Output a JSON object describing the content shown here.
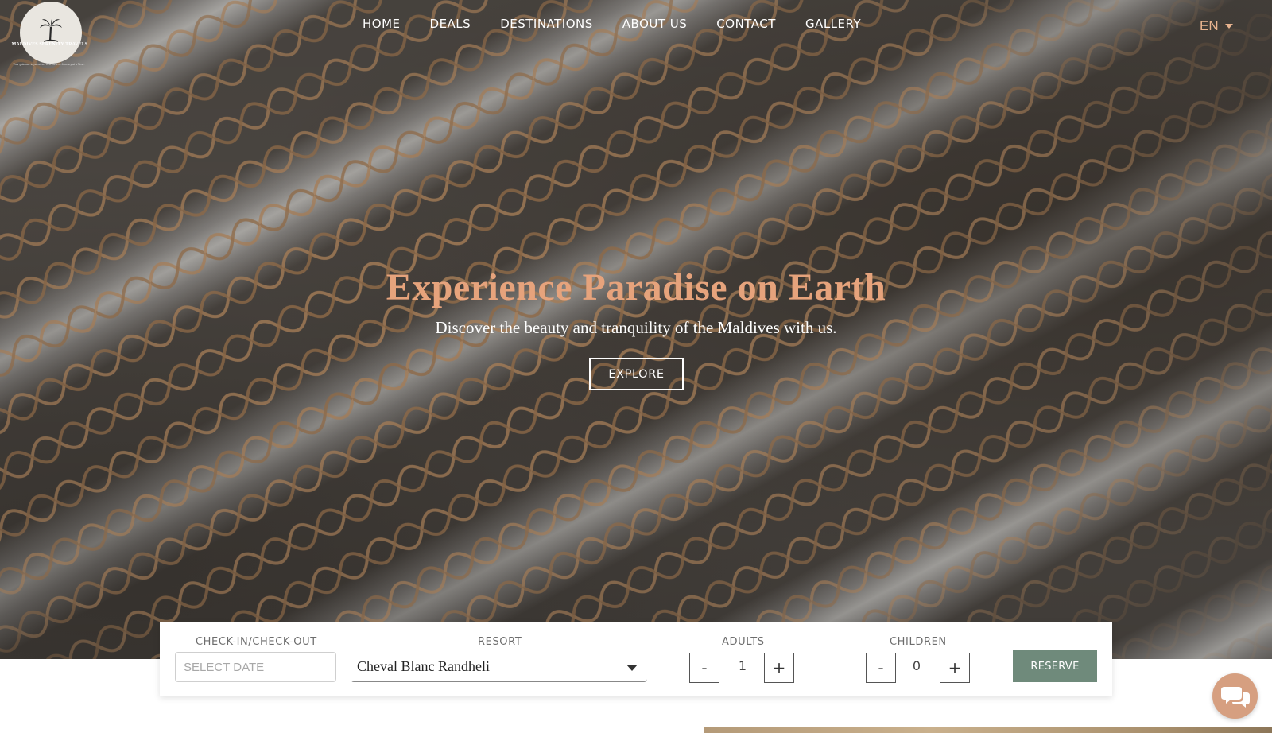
{
  "brand": {
    "name": "MALDIVES SERENITY TRAVELS",
    "tagline": "Your gateway to paradise. One Serene Journey at a Time."
  },
  "nav": {
    "items": [
      "HOME",
      "DEALS",
      "DESTINATIONS",
      "ABOUT US",
      "CONTACT",
      "GALLERY"
    ]
  },
  "language": {
    "selected": "EN"
  },
  "hero": {
    "title": "Experience Paradise on Earth",
    "subtitle": "Discover the beauty and tranquility of the Maldives with us.",
    "cta": "EXPLORE"
  },
  "booking": {
    "dates_label": "CHECK-IN/CHECK-OUT",
    "dates_placeholder": "SELECT DATE",
    "resort_label": "RESORT",
    "resort_value": "Cheval Blanc Randheli",
    "adults_label": "ADULTS",
    "adults_value": "1",
    "children_label": "CHILDREN",
    "children_value": "0",
    "minus": "-",
    "plus": "+",
    "reserve": "RESERVE"
  },
  "colors": {
    "accent": "#e6a37c",
    "reserve": "#6f8a7b",
    "chat": "#d69f80"
  },
  "icons": [
    "palm-tree-icon",
    "chevron-down-icon",
    "chat-icon"
  ]
}
